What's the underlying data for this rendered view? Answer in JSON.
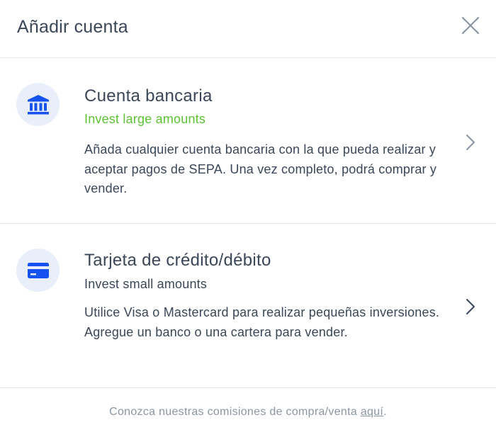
{
  "header": {
    "title": "Añadir cuenta"
  },
  "options": [
    {
      "title": "Cuenta bancaria",
      "subtitle": "Invest large amounts",
      "subtitle_color": "#5ec234",
      "description": "Añada cualquier cuenta bancaria con la que pueda realizar y aceptar pagos de SEPA. Una vez completo, podrá comprar y vender.",
      "icon": "bank-icon"
    },
    {
      "title": "Tarjeta de crédito/débito",
      "subtitle": "Invest small amounts",
      "description": "Utilice Visa o Mastercard para realizar pequeñas inversiones. Agregue un banco o una cartera para vender.",
      "icon": "credit-card-icon"
    }
  ],
  "footer": {
    "text": "Conozca nuestras comisiones de compra/venta ",
    "link_label": "aquí",
    "end": "."
  },
  "colors": {
    "accent_blue": "#1652f0",
    "icon_bg": "#e8effa",
    "green": "#5ec234"
  }
}
